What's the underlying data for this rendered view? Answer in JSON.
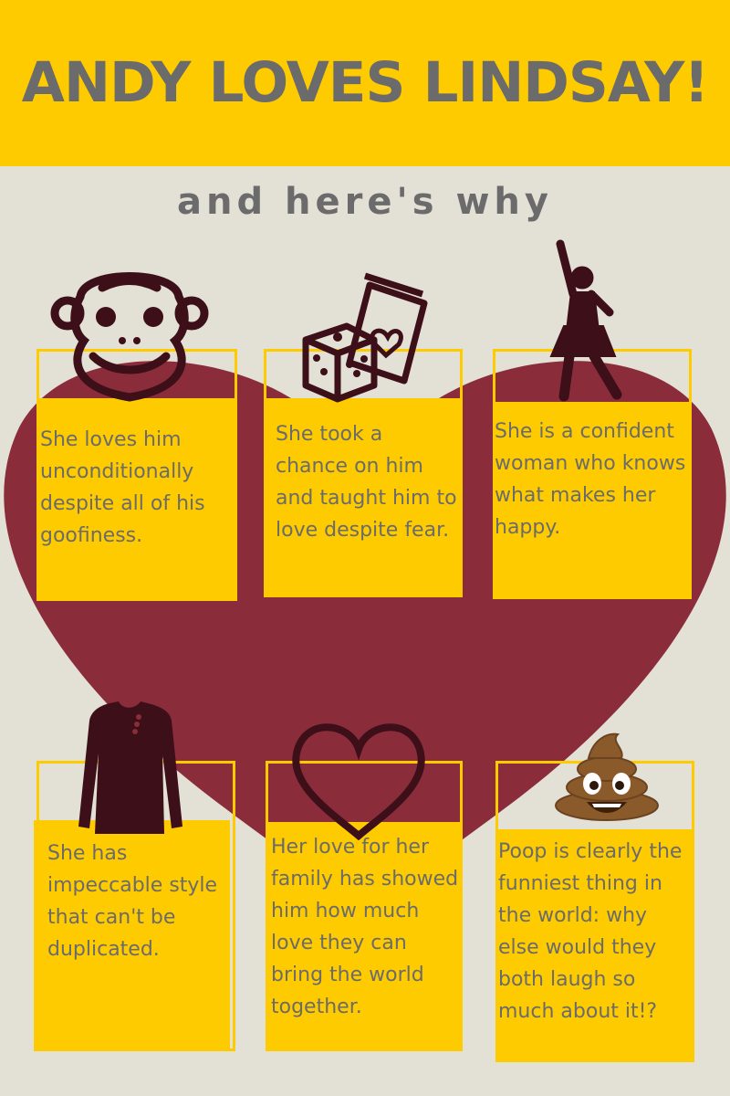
{
  "header": {
    "title": "ANDY LOVES LINDSAY!",
    "subtitle": "and here's why"
  },
  "colors": {
    "banner": "#fecb00",
    "background": "#e3e0d6",
    "heart": "#8b2c3a",
    "text": "#6b6b6b",
    "icon": "#3d0f18"
  },
  "reasons": [
    {
      "icon": "monkey-icon",
      "text": "She loves him unconditionally despite all of his goofiness."
    },
    {
      "icon": "dice-and-card-icon",
      "text": "She took a chance on him and taught him to love despite fear."
    },
    {
      "icon": "dancing-woman-icon",
      "text": "She is a confident woman who knows what makes her happy."
    },
    {
      "icon": "shirt-icon",
      "text": "She has impeccable style that can't be duplicated."
    },
    {
      "icon": "heart-outline-icon",
      "text": "Her love for her family has showed him how much love they can bring the world together."
    },
    {
      "icon": "poop-emoji-icon",
      "text": "Poop is clearly the funniest thing in the world: why else would they both laugh so much about it!?"
    }
  ]
}
